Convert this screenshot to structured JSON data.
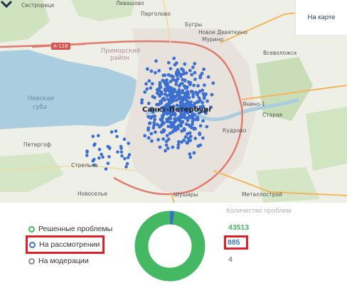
{
  "map": {
    "labels": {
      "sestroretsk": "Сестрорецк",
      "levashovo": "Левашово",
      "pargolovo": "Парголово",
      "bugry": "Бугры",
      "novoe_devyatkino": "Новое Девяткино",
      "murino": "Мурино",
      "primorsky": "Приморский",
      "primorsky2": "район",
      "vsevolozhsk": "Всеволожск",
      "nevskaya": "Невская",
      "guba": "губа",
      "spb": "Санкт-Петербург",
      "yanino": "Янино-1",
      "staraya": "Старая",
      "kudrovo": "Кудрово",
      "peterhof": "Петергоф",
      "strelna": "Стрельна",
      "novoselye": "Новоселье",
      "shushary": "Шушары",
      "metallostroy": "Металлострой"
    },
    "road": "A-118",
    "view_toggle": "На карте"
  },
  "legend": [
    {
      "label": "Решенные проблемы",
      "color": "#45b864"
    },
    {
      "label": "На рассмотрении",
      "color": "#3a74c4"
    },
    {
      "label": "На модерации",
      "color": "#8c8c8c"
    }
  ],
  "stats": {
    "header": "Количество проблем",
    "values": [
      {
        "value": "43513",
        "color": "#45b864"
      },
      {
        "value": "885",
        "color": "#3a74c4"
      },
      {
        "value": "4",
        "color": "#8c8c8c"
      }
    ]
  }
}
